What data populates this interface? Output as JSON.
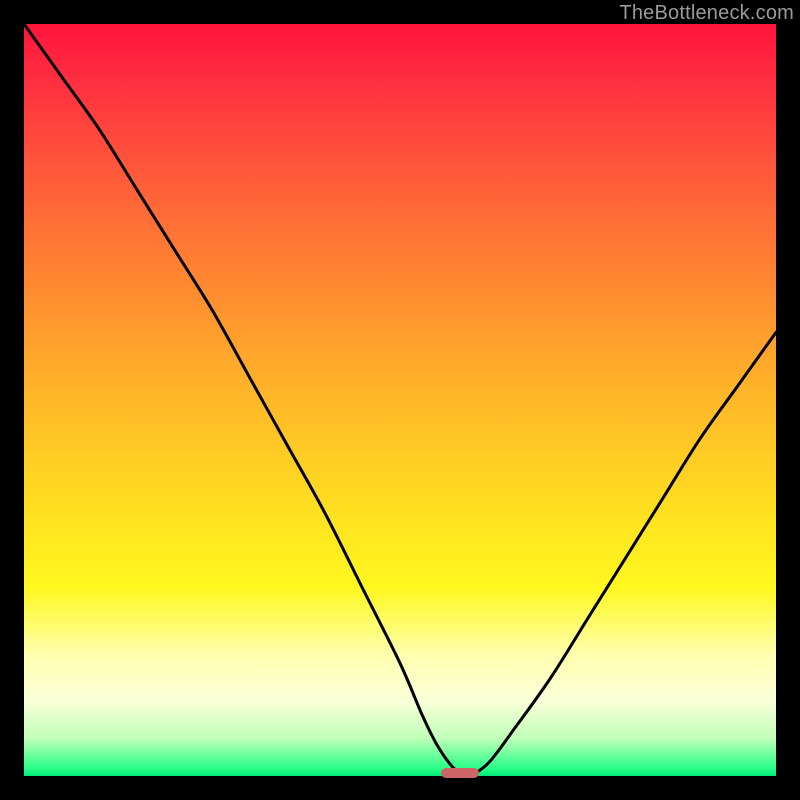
{
  "watermark": "TheBottleneck.com",
  "colors": {
    "frame": "#000000",
    "curve": "#000000",
    "marker": "#cc6666",
    "gradient_top": "#ff143c",
    "gradient_bottom": "#00e878"
  },
  "chart_data": {
    "type": "line",
    "title": "",
    "xlabel": "",
    "ylabel": "",
    "xlim": [
      0,
      100
    ],
    "ylim": [
      0,
      100
    ],
    "x": [
      0,
      5,
      10,
      15,
      20,
      25,
      30,
      35,
      40,
      45,
      50,
      53,
      55,
      57,
      58.5,
      60,
      62,
      65,
      70,
      75,
      80,
      85,
      90,
      95,
      100
    ],
    "values": [
      100,
      93,
      86,
      78,
      70,
      62,
      53,
      44,
      35,
      25,
      15,
      8,
      4,
      1.2,
      0.2,
      0.4,
      2,
      6,
      13,
      21,
      29,
      37,
      45,
      52,
      59
    ],
    "marker": {
      "x_center": 58,
      "width": 5,
      "y": 0.4
    }
  }
}
